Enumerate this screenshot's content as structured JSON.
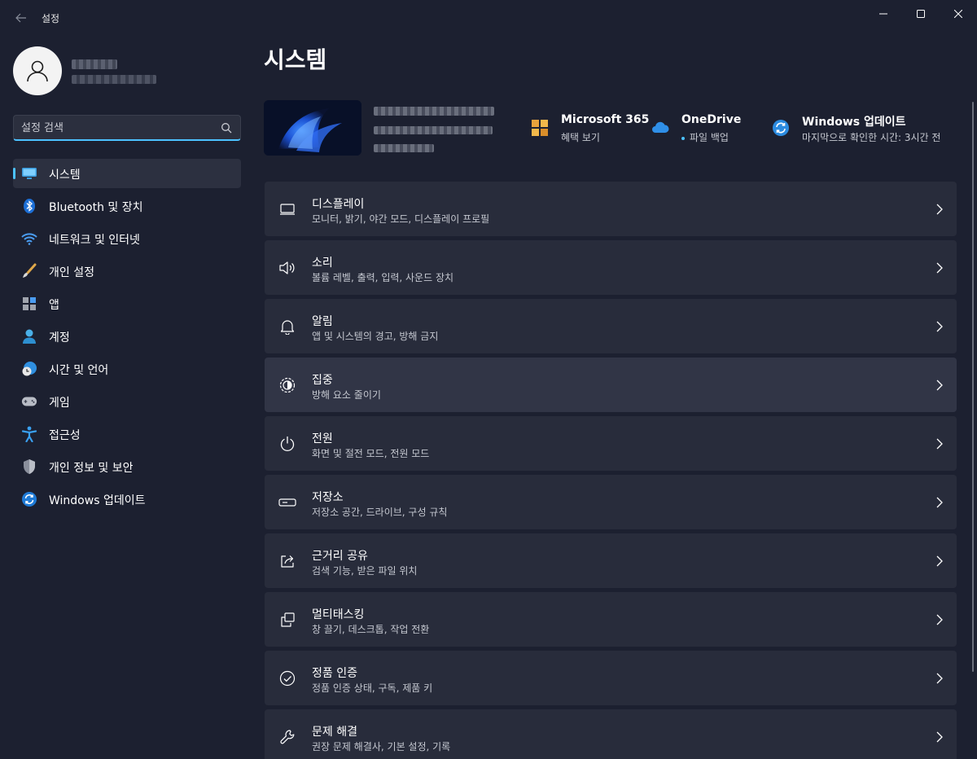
{
  "window": {
    "title": "설정",
    "controls": [
      "minimize-icon",
      "maximize-icon",
      "close-icon"
    ]
  },
  "sidebar": {
    "search": {
      "placeholder": "설정 검색",
      "value": ""
    },
    "items": [
      {
        "label": "시스템",
        "icon": "system-icon",
        "selected": true
      },
      {
        "label": "Bluetooth 및 장치",
        "icon": "bluetooth-icon",
        "selected": false
      },
      {
        "label": "네트워크 및 인터넷",
        "icon": "wifi-icon",
        "selected": false
      },
      {
        "label": "개인 설정",
        "icon": "brush-icon",
        "selected": false
      },
      {
        "label": "앱",
        "icon": "apps-icon",
        "selected": false
      },
      {
        "label": "계정",
        "icon": "account-icon",
        "selected": false
      },
      {
        "label": "시간 및 언어",
        "icon": "globe-clock-icon",
        "selected": false
      },
      {
        "label": "게임",
        "icon": "gamepad-icon",
        "selected": false
      },
      {
        "label": "접근성",
        "icon": "accessibility-icon",
        "selected": false
      },
      {
        "label": "개인 정보 및 보안",
        "icon": "shield-icon",
        "selected": false
      },
      {
        "label": "Windows 업데이트",
        "icon": "update-icon",
        "selected": false
      }
    ]
  },
  "main": {
    "title": "시스템",
    "quick_actions": [
      {
        "title": "Microsoft 365",
        "subtitle": "혜택 보기",
        "icon": "microsoft365-icon"
      },
      {
        "title": "OneDrive",
        "subtitle": "파일 백업",
        "icon": "onedrive-icon"
      },
      {
        "title": "Windows 업데이트",
        "subtitle": "마지막으로 확인한 시간: 3시간 전",
        "icon": "update-icon"
      }
    ],
    "settings": [
      {
        "title": "디스플레이",
        "subtitle": "모니터, 밝기, 야간 모드, 디스플레이 프로필",
        "icon": "display-icon"
      },
      {
        "title": "소리",
        "subtitle": "볼륨 레벨, 출력, 입력, 사운드 장치",
        "icon": "speaker-icon"
      },
      {
        "title": "알림",
        "subtitle": "앱 및 시스템의 경고, 방해 금지",
        "icon": "bell-icon"
      },
      {
        "title": "집중",
        "subtitle": "방해 요소 줄이기",
        "icon": "focus-icon"
      },
      {
        "title": "전원",
        "subtitle": "화면 및 절전 모드, 전원 모드",
        "icon": "power-icon"
      },
      {
        "title": "저장소",
        "subtitle": "저장소 공간, 드라이브, 구성 규칙",
        "icon": "storage-icon"
      },
      {
        "title": "근거리 공유",
        "subtitle": "검색 기능, 받은 파일 위치",
        "icon": "share-icon"
      },
      {
        "title": "멀티태스킹",
        "subtitle": "창 끌기, 데스크톱, 작업 전환",
        "icon": "multitask-icon"
      },
      {
        "title": "정품 인증",
        "subtitle": "정품 인증 상태, 구독, 제품 키",
        "icon": "activation-icon"
      },
      {
        "title": "문제 해결",
        "subtitle": "권장 문제 해결사, 기본 설정, 기록",
        "icon": "wrench-icon"
      }
    ]
  },
  "colors": {
    "background": "#1c2030",
    "card": "#282c3b",
    "accent": "#4cc2ff"
  }
}
